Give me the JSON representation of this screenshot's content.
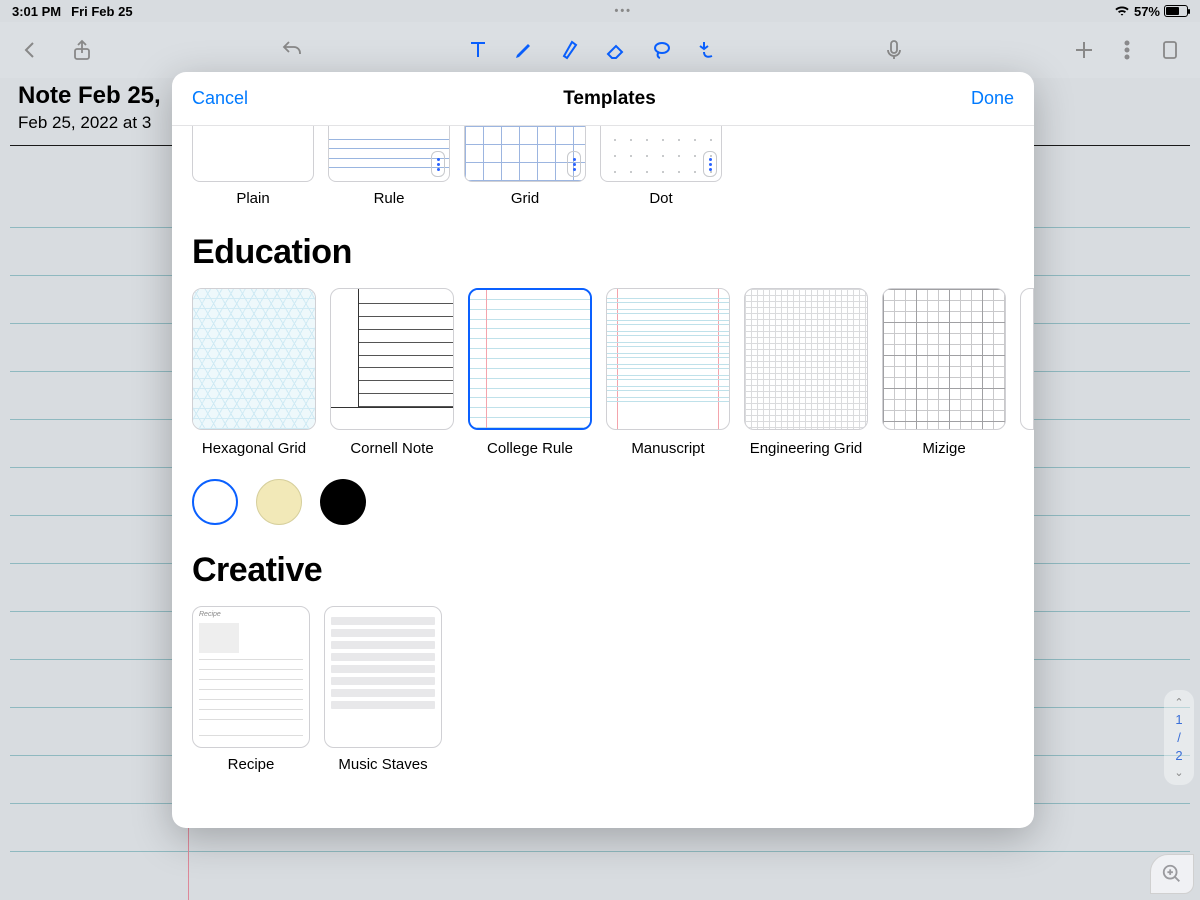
{
  "status": {
    "time": "3:01 PM",
    "date": "Fri Feb 25",
    "battery_pct": "57%"
  },
  "note": {
    "title": "Note Feb 25,",
    "subtitle": "Feb 25, 2022 at 3"
  },
  "pager": {
    "current": "1",
    "sep": "/",
    "total": "2"
  },
  "modal": {
    "cancel": "Cancel",
    "title": "Templates",
    "done": "Done",
    "basic": {
      "plain": "Plain",
      "rule": "Rule",
      "grid": "Grid",
      "dot": "Dot"
    },
    "sections": {
      "education": "Education",
      "creative": "Creative"
    },
    "education": {
      "hex": "Hexagonal Grid",
      "cornell": "Cornell Note",
      "college": "College Rule",
      "manuscript": "Manuscript",
      "eng": "Engineering Grid",
      "mizige": "Mizige"
    },
    "colors": {
      "white": "white",
      "cream": "cream",
      "black": "black"
    },
    "creative": {
      "recipe": "Recipe",
      "staves": "Music Staves"
    }
  }
}
